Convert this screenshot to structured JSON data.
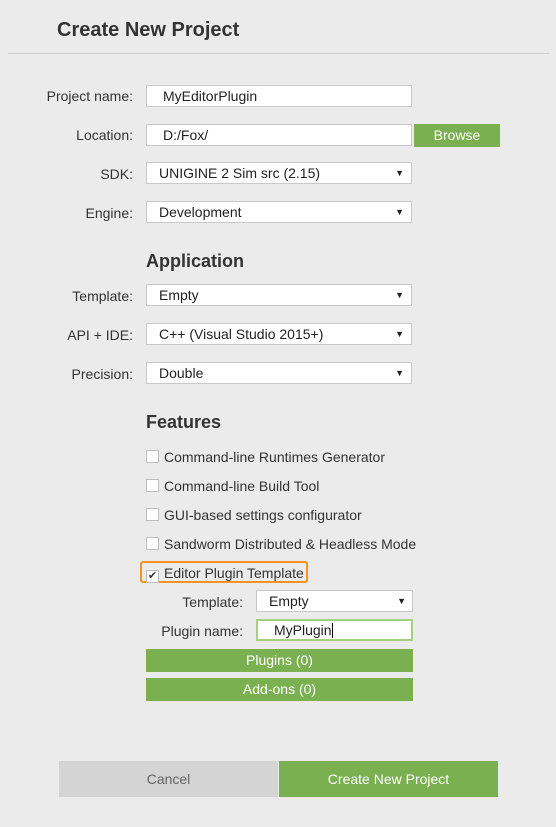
{
  "window": {
    "title": "Create New Project"
  },
  "form": {
    "project_name": {
      "label": "Project name:",
      "value": "MyEditorPlugin"
    },
    "location": {
      "label": "Location:",
      "value": "D:/Fox/",
      "browse_label": "Browse"
    },
    "sdk": {
      "label": "SDK:",
      "value": "UNIGINE 2 Sim src (2.15)"
    },
    "engine": {
      "label": "Engine:",
      "value": "Development"
    }
  },
  "application": {
    "heading": "Application",
    "template": {
      "label": "Template:",
      "value": "Empty"
    },
    "api_ide": {
      "label": "API + IDE:",
      "value": "C++ (Visual Studio 2015+)"
    },
    "precision": {
      "label": "Precision:",
      "value": "Double"
    }
  },
  "features": {
    "heading": "Features",
    "items": [
      {
        "label": "Command-line Runtimes Generator",
        "checked": false
      },
      {
        "label": "Command-line Build Tool",
        "checked": false
      },
      {
        "label": "GUI-based settings configurator",
        "checked": false
      },
      {
        "label": "Sandworm Distributed & Headless Mode",
        "checked": false
      },
      {
        "label": "Editor Plugin Template",
        "checked": true
      }
    ],
    "check_glyph": "✔",
    "plugin_template": {
      "label": "Template:",
      "value": "Empty"
    },
    "plugin_name": {
      "label": "Plugin name:",
      "value": "MyPlugin"
    }
  },
  "extras": {
    "plugins_label": "Plugins (0)",
    "addons_label": "Add-ons (0)"
  },
  "footer": {
    "cancel_label": "Cancel",
    "create_label": "Create New Project"
  },
  "icons": {
    "dropdown_arrow": "▼"
  },
  "colors": {
    "accent_green": "#7ab050",
    "highlight_orange": "#f7931e",
    "background": "#ebebeb"
  }
}
